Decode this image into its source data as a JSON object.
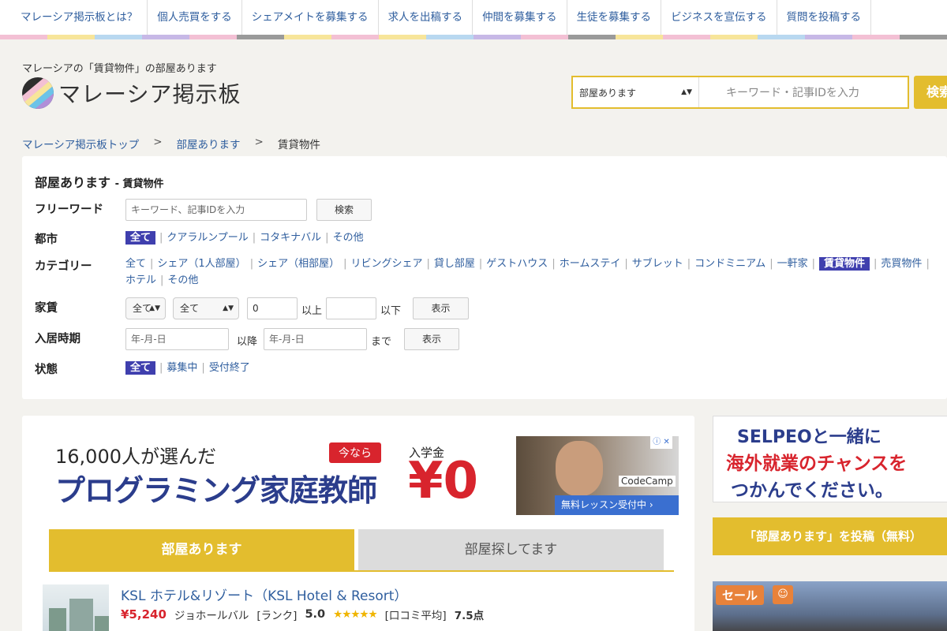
{
  "nav": [
    "マレーシア掲示板とは？",
    "個人売買をする",
    "シェアメイトを募集する",
    "求人を出稿する",
    "仲間を募集する",
    "生徒を募集する",
    "ビジネスを宣伝する",
    "質問を投稿する"
  ],
  "header": {
    "tagline": "マレーシアの「賃貸物件」の部屋あります",
    "site_title": "マレーシア掲示板",
    "search_select": "部屋あります",
    "search_placeholder": "キーワード・記事IDを入力",
    "search_button": "検索"
  },
  "breadcrumb": [
    "マレーシア掲示板トップ",
    "部屋あります",
    "賃貸物件"
  ],
  "filter": {
    "title": "部屋あります",
    "subtitle": "- 賃貸物件",
    "freeword_label": "フリーワード",
    "freeword_placeholder": "キーワード、記事IDを入力",
    "freeword_button": "検索",
    "city_label": "都市",
    "cities": [
      "全て",
      "クアラルンプール",
      "コタキナバル",
      "その他"
    ],
    "category_label": "カテゴリー",
    "categories_row1": [
      "全て",
      "シェア（1人部屋）",
      "シェア（相部屋）",
      "リビングシェア",
      "貸し部屋",
      "ゲストハウス",
      "ホームステイ",
      "サブレット",
      "コンドミニアム",
      "一軒家",
      "賃貸物件",
      "売買物件"
    ],
    "categories_row2": [
      "ホテル",
      "その他"
    ],
    "rent_label": "家賃",
    "rent_select1": "全て",
    "rent_select2": "全て",
    "rent_min": "0",
    "rent_min_suffix": "以上",
    "rent_max_suffix": "以下",
    "rent_button": "表示",
    "movein_label": "入居時期",
    "movein_from_placeholder": "年-月-日",
    "movein_from_suffix": "以降",
    "movein_to_placeholder": "年-月-日",
    "movein_to_suffix": "まで",
    "movein_button": "表示",
    "status_label": "状態",
    "statuses": [
      "全て",
      "募集中",
      "受付終了"
    ]
  },
  "ad": {
    "line1": "16,000人が選んだ",
    "line2": "プログラミング家庭教師",
    "badge": "今なら",
    "label": "入学金",
    "amount": "¥0",
    "brand": "CodeCamp",
    "cta": "無料レッスン受付中 ›",
    "info": "ⓘ ✕"
  },
  "tabs": {
    "active": "部屋あります",
    "inactive": "部屋探してます"
  },
  "listing": {
    "title": "KSL ホテル&リゾート（KSL Hotel & Resort）",
    "price": "¥5,240",
    "location": "ジョホールバル",
    "rank_label": "[ランク]",
    "rank": "5.0",
    "stars": "★★★★★",
    "review_label": "[口コミ平均]",
    "review": "7.5点"
  },
  "side": {
    "banner_l1": "SELPEOと一緒に",
    "banner_l2": "海外就業のチャンスを",
    "banner_l3": "つかんでください。",
    "post_button": "「部屋あります」を投稿（無料）",
    "sale_badge": "セール",
    "sale_icon": "☺"
  },
  "colors": {
    "accent": "#e3bd2e",
    "link": "#2f5e9e",
    "active_chip": "#3f3fae",
    "price": "#d8242d"
  }
}
